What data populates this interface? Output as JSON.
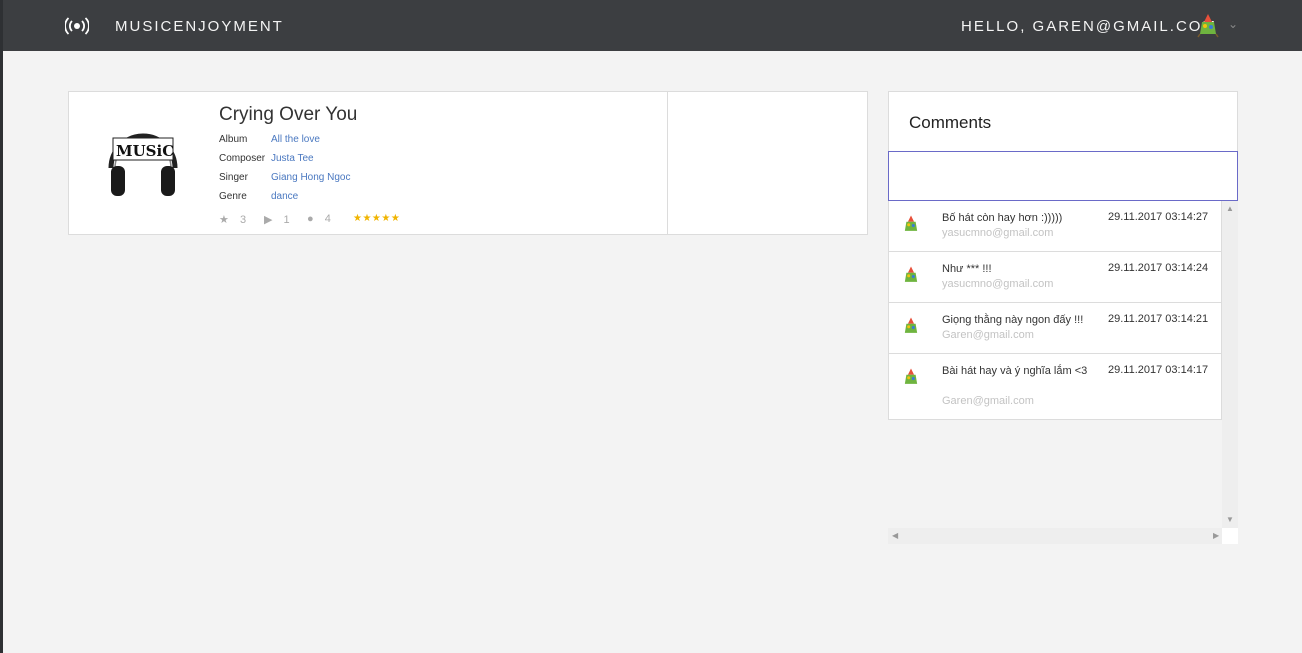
{
  "navbar": {
    "brand": "MUSICENJOYMENT",
    "brand_icon": "broadcast-icon",
    "greeting": "HELLO, GAREN@GMAIL.COM",
    "avatar_icon": "user-avatar-icon",
    "caret_icon": "chevron-down-icon"
  },
  "song": {
    "title": "Crying Over You",
    "cover_icon": "headphones-music-cover",
    "fields": [
      {
        "label": "Album",
        "value": "All the love"
      },
      {
        "label": "Composer",
        "value": "Justa Tee"
      },
      {
        "label": "Singer",
        "value": "Giang Hong Ngoc"
      },
      {
        "label": "Genre",
        "value": "dance"
      }
    ],
    "stats": {
      "favorites": "3",
      "plays": "1",
      "comments": "4",
      "rating_stars": "★★★★★"
    }
  },
  "comments": {
    "title": "Comments",
    "input_value": "",
    "items": [
      {
        "text": "Bố hát còn hay hơn :)))))",
        "email": "yasucmno@gmail.com",
        "time": "29.11.2017 03:14:27"
      },
      {
        "text": "Như *** !!!",
        "email": "yasucmno@gmail.com",
        "time": "29.11.2017 03:14:24"
      },
      {
        "text": "Giọng thằng này ngon đấy !!!",
        "email": "Garen@gmail.com",
        "time": "29.11.2017 03:14:21"
      },
      {
        "text": "Bài hát hay và ý nghĩa lắm <3",
        "email": "Garen@gmail.com",
        "time": "29.11.2017 03:14:17"
      }
    ]
  },
  "colors": {
    "navbar": "#3c3e41",
    "link": "#4a78c0",
    "star": "#f0b400",
    "input_border": "#6a6ac8"
  }
}
